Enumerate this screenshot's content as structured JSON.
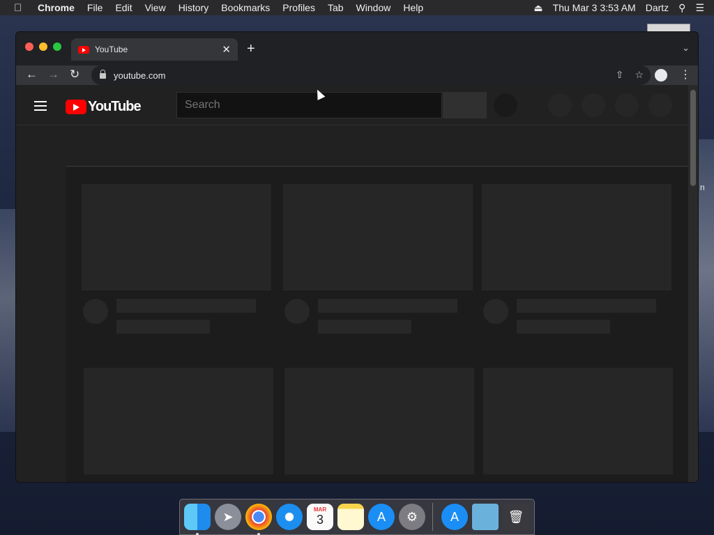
{
  "menubar": {
    "app": "Chrome",
    "items": [
      "File",
      "Edit",
      "View",
      "History",
      "Bookmarks",
      "Profiles",
      "Tab",
      "Window",
      "Help"
    ],
    "clock": "Thu Mar 3  3:53 AM",
    "user": "Dartz"
  },
  "browser": {
    "tab_title": "YouTube",
    "new_tab": "+",
    "url": "youtube.com"
  },
  "youtube": {
    "logo_text": "YouTube",
    "search_placeholder": "Search"
  },
  "dock": {
    "apps": [
      "Finder",
      "Launchpad",
      "Google Chrome",
      "Safari",
      "Calendar",
      "Notes",
      "App Store",
      "System Preferences",
      "Applications",
      "Downloads",
      "Trash"
    ],
    "calendar_month": "MAR",
    "calendar_day": "3"
  },
  "desktop": {
    "edge_text": "n"
  }
}
